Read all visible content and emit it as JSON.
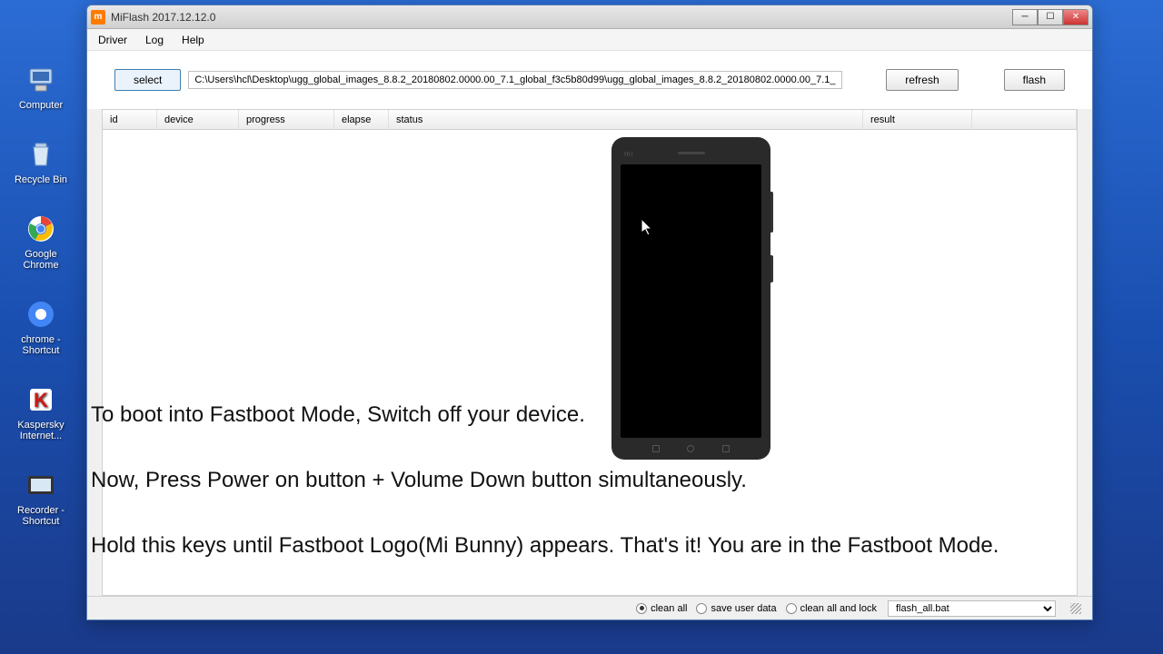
{
  "desktop": {
    "icons": [
      {
        "label": "Computer"
      },
      {
        "label": "Recycle Bin"
      },
      {
        "label": "Google Chrome"
      },
      {
        "label": "chrome - Shortcut"
      },
      {
        "label": "Kaspersky Internet..."
      },
      {
        "label": "Recorder - Shortcut"
      }
    ]
  },
  "window": {
    "title": "MiFlash 2017.12.12.0",
    "menu": {
      "driver": "Driver",
      "log": "Log",
      "help": "Help"
    },
    "buttons": {
      "select": "select",
      "refresh": "refresh",
      "flash": "flash"
    },
    "path": "C:\\Users\\hcl\\Desktop\\ugg_global_images_8.8.2_20180802.0000.00_7.1_global_f3c5b80d99\\ugg_global_images_8.8.2_20180802.0000.00_7.1_",
    "columns": {
      "id": "id",
      "device": "device",
      "progress": "progress",
      "elapse": "elapse",
      "status": "status",
      "result": "result"
    },
    "radios": {
      "clean_all": "clean all",
      "save_user_data": "save user data",
      "clean_all_and_lock": "clean all and lock"
    },
    "script": "flash_all.bat"
  },
  "overlay": {
    "line1": "To boot into Fastboot Mode, Switch off your device.",
    "line2": "Now, Press Power on button + Volume Down button simultaneously.",
    "line3": "Hold this keys until Fastboot Logo(Mi Bunny) appears. That's it! You are in the Fastboot Mode."
  }
}
